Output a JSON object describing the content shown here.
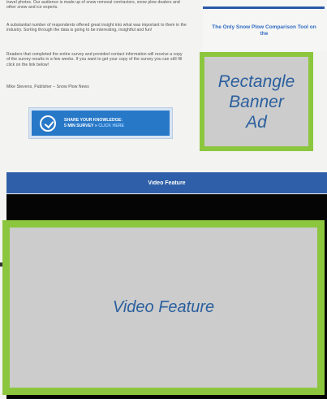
{
  "article": {
    "paragraphs": [
      "travel photos. Our audience is made up of snow removal contractors, snow plow dealers and other snow and ice experts.",
      "A substantial number of respondents offered great insight into what was important to them in the industry. Sorting through the data is going to be interesting, insightful and fun!",
      "Readers that completed the entire survey and provided contact information will receive a copy of the survey results in a few weeks. If you want to get your copy of the survey you can still fill click on the link below!",
      "Mike Stevens, Publisher – Snow Plow News"
    ],
    "survey_button": {
      "line1": "SHARE YOUR KNOWLEDGE:",
      "line2": "5 MIN SURVEY »",
      "link": "CLICK HERE"
    }
  },
  "sidebar": {
    "comparison_title": "The Only Snow Plow Comparison Tool on the",
    "ad_label": "Rectangle\nBanner\nAd"
  },
  "video": {
    "header": "Video Feature",
    "placeholder_label": "Video Feature"
  },
  "colors": {
    "accent_green": "#8cc63f",
    "placeholder_gray": "#cccccc",
    "placeholder_text_blue": "#2a5f9e",
    "header_blue": "#2e5fa8",
    "button_blue": "#2878c8"
  }
}
